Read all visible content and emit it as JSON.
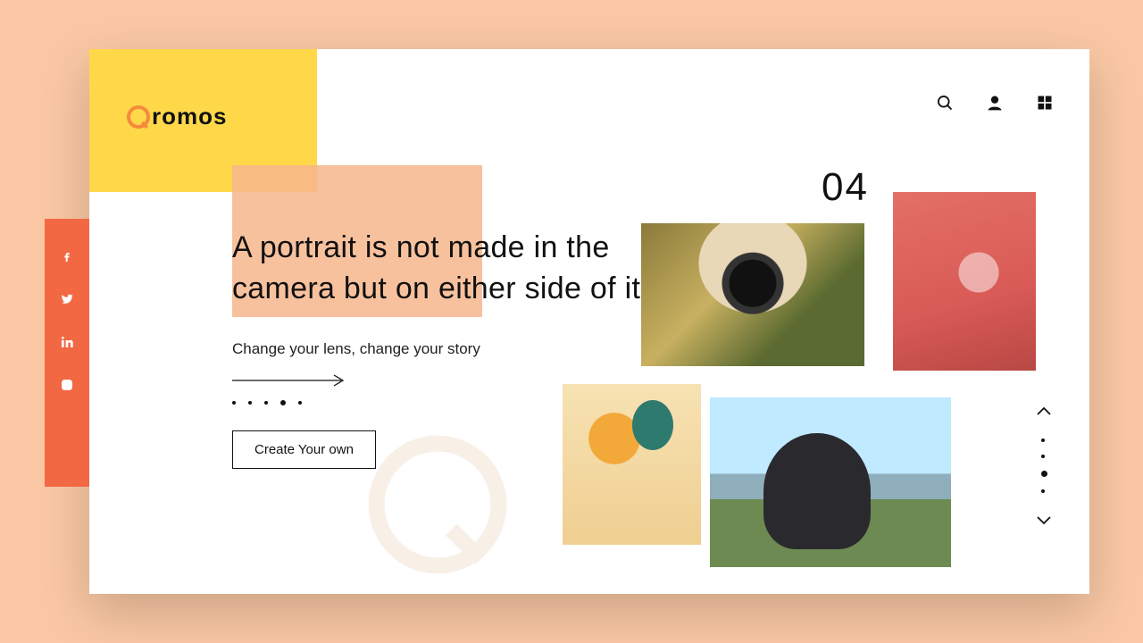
{
  "brand": {
    "name": "romos"
  },
  "nav": {
    "search": "search",
    "profile": "profile",
    "grid": "apps"
  },
  "social": {
    "facebook": "facebook",
    "twitter": "twitter",
    "linkedin": "linkedin",
    "instagram": "instagram"
  },
  "hero": {
    "headline": "A portrait is not made in the camera but on either side of it",
    "subtitle": "Change your lens, change your story",
    "cta": "Create Your own",
    "slide_count": 5,
    "slide_active_index": 3
  },
  "counter": "04",
  "pager": {
    "count": 4,
    "active_index": 2
  },
  "colors": {
    "bg": "#f9c7a3",
    "yellow": "#ffd84a",
    "peach": "#f7b68c",
    "coral": "#f26843",
    "accent": "#f58a3c"
  }
}
